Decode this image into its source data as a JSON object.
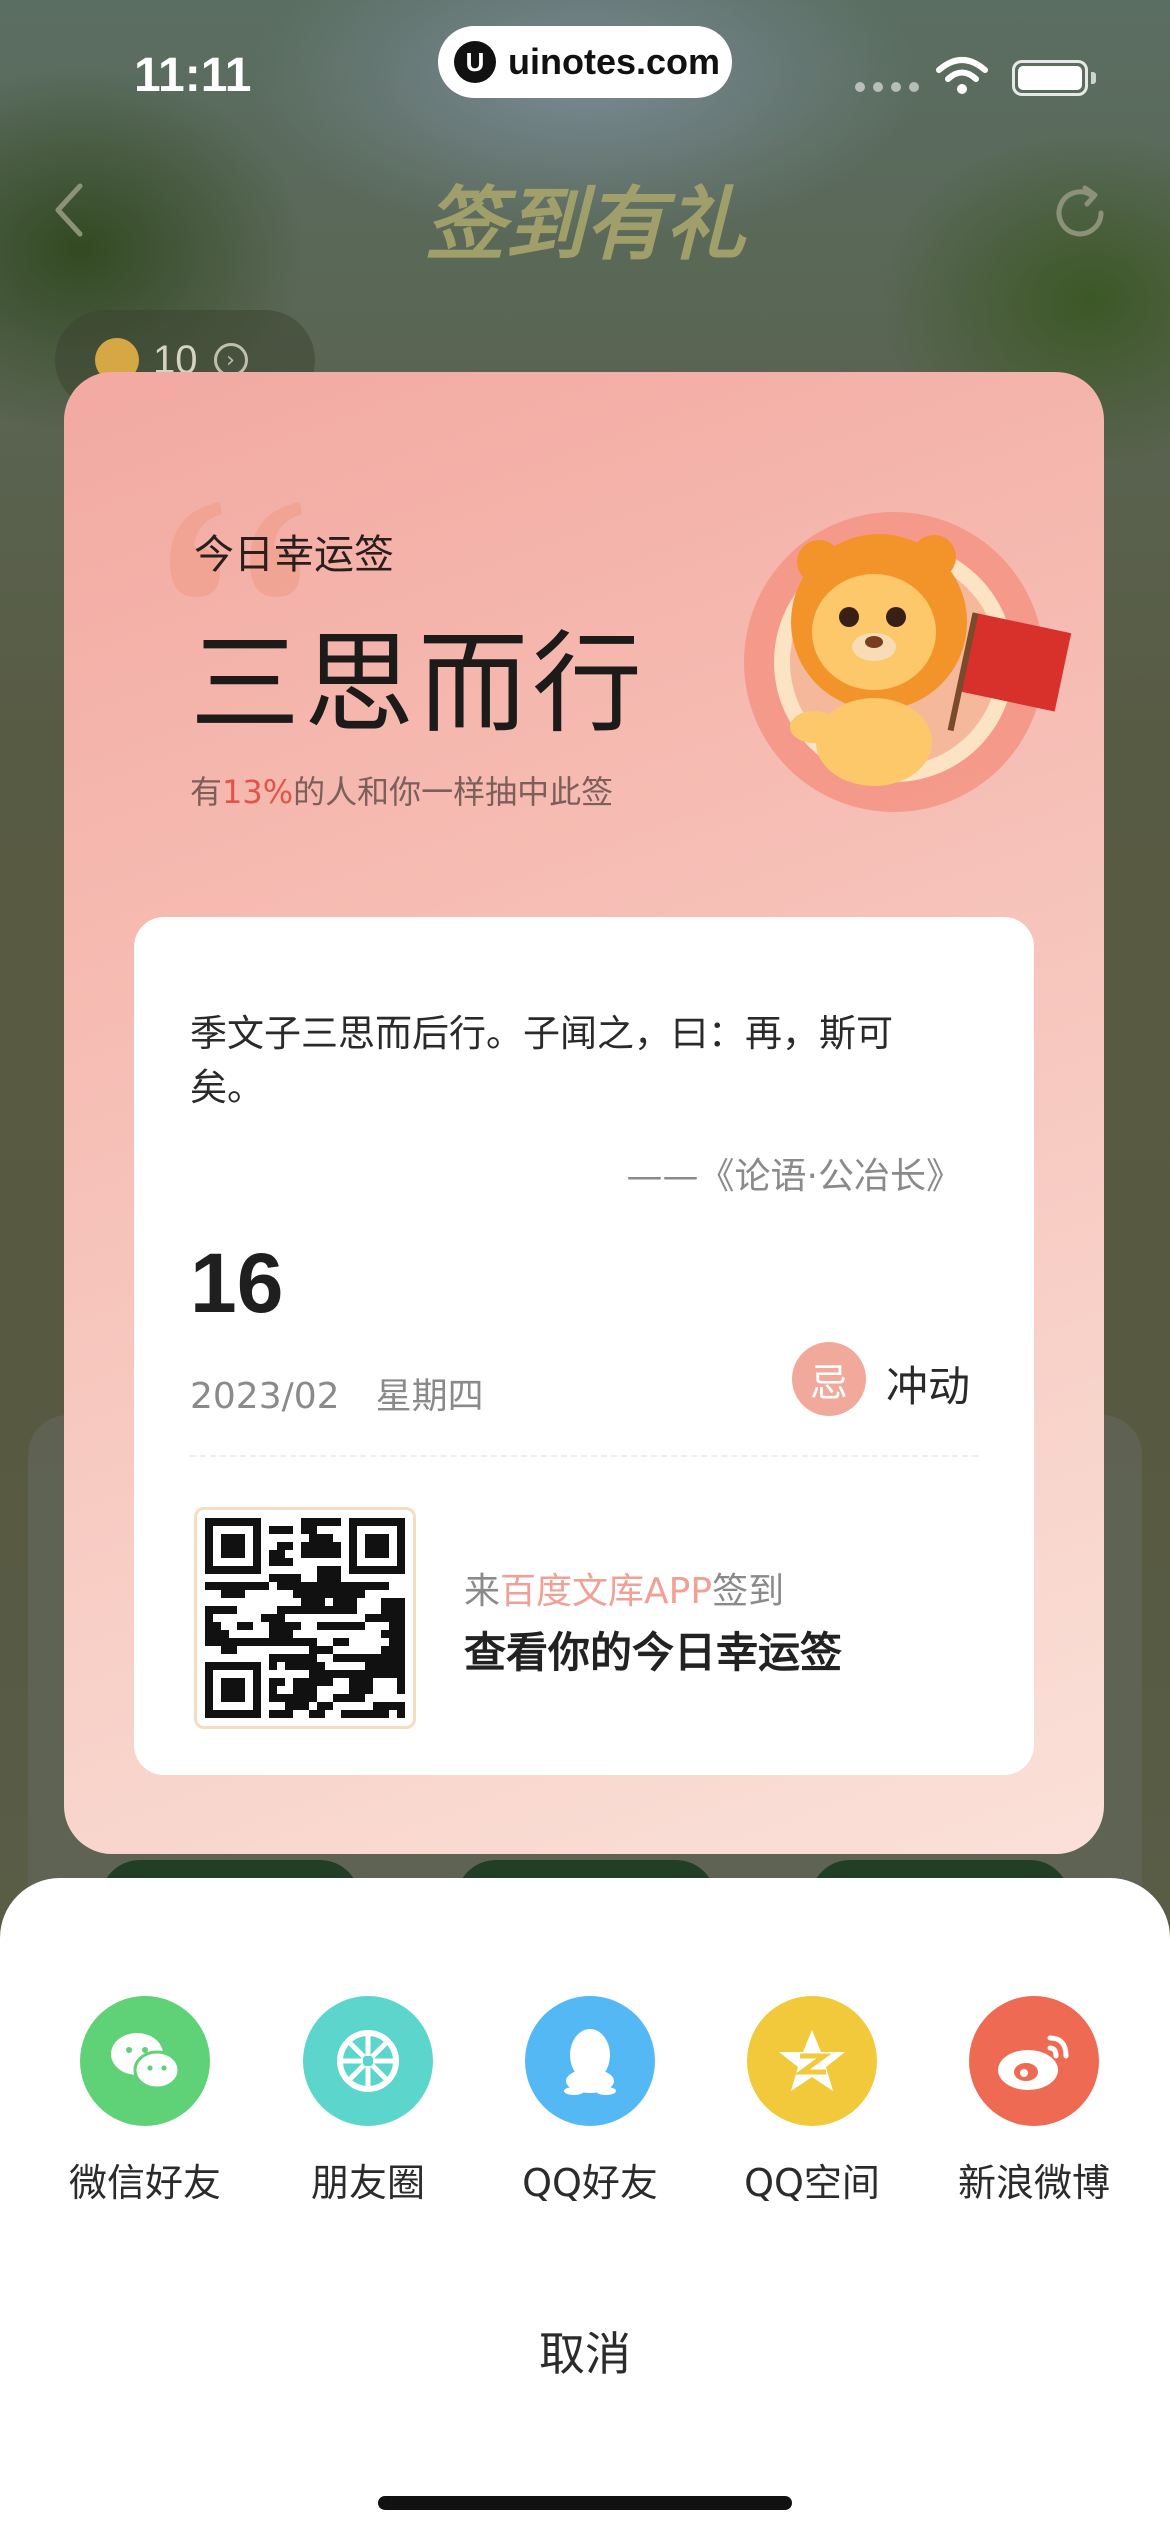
{
  "status_bar": {
    "time": "11:11",
    "url": "uinotes.com",
    "url_logo": "U"
  },
  "background": {
    "title": "签到有礼",
    "coin_count": "10"
  },
  "card": {
    "label": "今日幸运签",
    "title": "三思而行",
    "stat_prefix": "有",
    "stat_percent": "13%",
    "stat_suffix": "的人和你一样抽中此签",
    "quote": "季文子三思而后行。子闻之，曰：再，斯可矣。",
    "source": "——《论语·公冶长》",
    "day": "16",
    "year_month": "2023/02",
    "weekday": "星期四",
    "avoid_badge": "忌",
    "avoid_text": "冲动",
    "qr_cta_prefix": "来",
    "qr_cta_highlight": "百度文库APP",
    "qr_cta_suffix": "签到",
    "qr_cta_main": "查看你的今日幸运签"
  },
  "share_sheet": {
    "items": [
      {
        "label": "微信好友",
        "icon": "wechat-icon",
        "color": "#5fd177"
      },
      {
        "label": "朋友圈",
        "icon": "moments-icon",
        "color": "#5cd6cc"
      },
      {
        "label": "QQ好友",
        "icon": "qq-icon",
        "color": "#54b8f5"
      },
      {
        "label": "QQ空间",
        "icon": "qzone-icon",
        "color": "#f2c93a"
      },
      {
        "label": "新浪微博",
        "icon": "weibo-icon",
        "color": "#ef6a52"
      }
    ],
    "cancel": "取消"
  },
  "colors": {
    "accent_red": "#e0554a",
    "highlight_pink": "#f2a095"
  }
}
